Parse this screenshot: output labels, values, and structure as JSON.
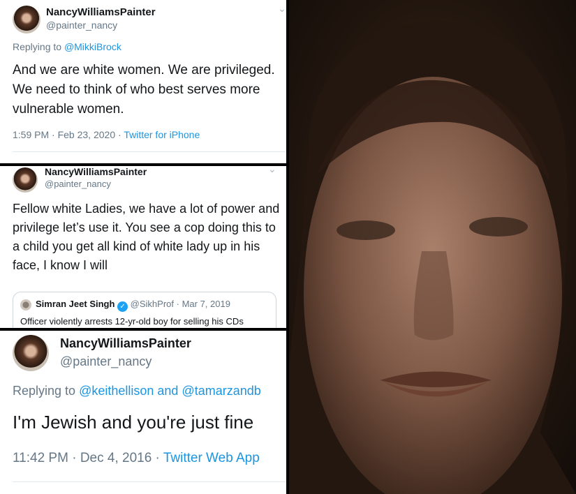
{
  "tweet1": {
    "name": "NancyWilliamsPainter",
    "handle": "@painter_nancy",
    "replying_prefix": "Replying to ",
    "replying_to": "@MikkiBrock",
    "text": "And we are white women. We are privileged. We need to think of who best serves more vulnerable women.",
    "time": "1:59 PM",
    "date": "Feb 23, 2020",
    "separator": " · ",
    "source": "Twitter for iPhone"
  },
  "tweet2": {
    "name": "NancyWilliamsPainter",
    "handle": "@painter_nancy",
    "text": "Fellow white Ladies, we have a lot of power and privilege let’s use it. You see a cop doing this to a child you get all kind of white lady up in his face, I know I will",
    "quote": {
      "name": "Simran Jeet Singh",
      "handle": "@SikhProf",
      "date": "Mar 7, 2019",
      "separator": " · ",
      "text": "Officer violently arrests 12-yr-old boy for selling his CDs"
    }
  },
  "tweet3": {
    "name": "NancyWilliamsPainter",
    "handle": "@painter_nancy",
    "replying_prefix": "Replying to ",
    "replying_to": "@keithellison and @tamarzandb",
    "text": "I'm Jewish and you're just fine",
    "time": "11:42 PM",
    "date": "Dec 4, 2016",
    "separator": " · ",
    "source": "Twitter Web App"
  },
  "icons": {
    "chevron": "chevron-down-icon",
    "verified": "verified-badge-icon"
  },
  "colors": {
    "link": "#1b95e0",
    "meta": "#657786",
    "text": "#14171a",
    "background": "#000000"
  }
}
